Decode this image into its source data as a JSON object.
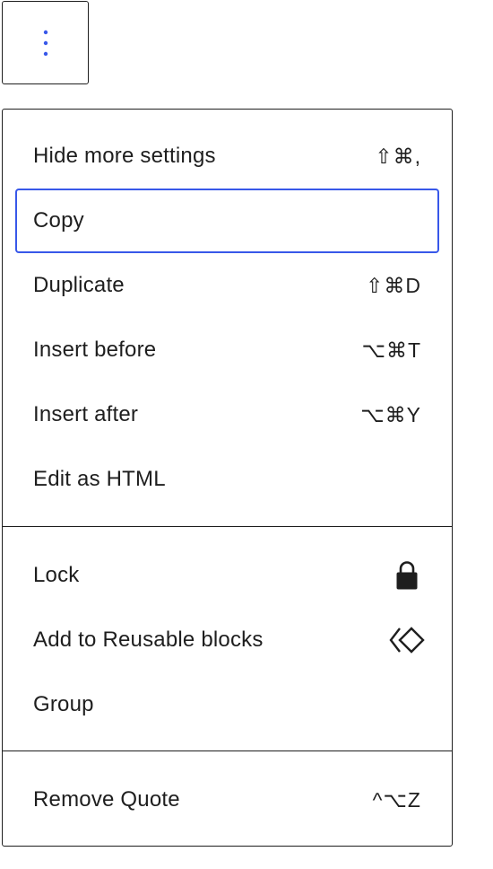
{
  "toolbar": {
    "options_icon": "vertical-ellipsis-icon",
    "accent_color": "#3858e9"
  },
  "menu": {
    "groups": [
      {
        "items": [
          {
            "label": "Hide more settings",
            "shortcut": "⇧⌘,"
          },
          {
            "label": "Copy",
            "shortcut": "",
            "focused": true
          },
          {
            "label": "Duplicate",
            "shortcut": "⇧⌘D"
          },
          {
            "label": "Insert before",
            "shortcut": "⌥⌘T"
          },
          {
            "label": "Insert after",
            "shortcut": "⌥⌘Y"
          },
          {
            "label": "Edit as HTML",
            "shortcut": ""
          }
        ]
      },
      {
        "items": [
          {
            "label": "Lock",
            "icon": "lock-icon"
          },
          {
            "label": "Add to Reusable blocks",
            "icon": "reusable-block-icon"
          },
          {
            "label": "Group"
          }
        ]
      },
      {
        "items": [
          {
            "label": "Remove Quote",
            "shortcut": "^⌥Z"
          }
        ]
      }
    ]
  }
}
